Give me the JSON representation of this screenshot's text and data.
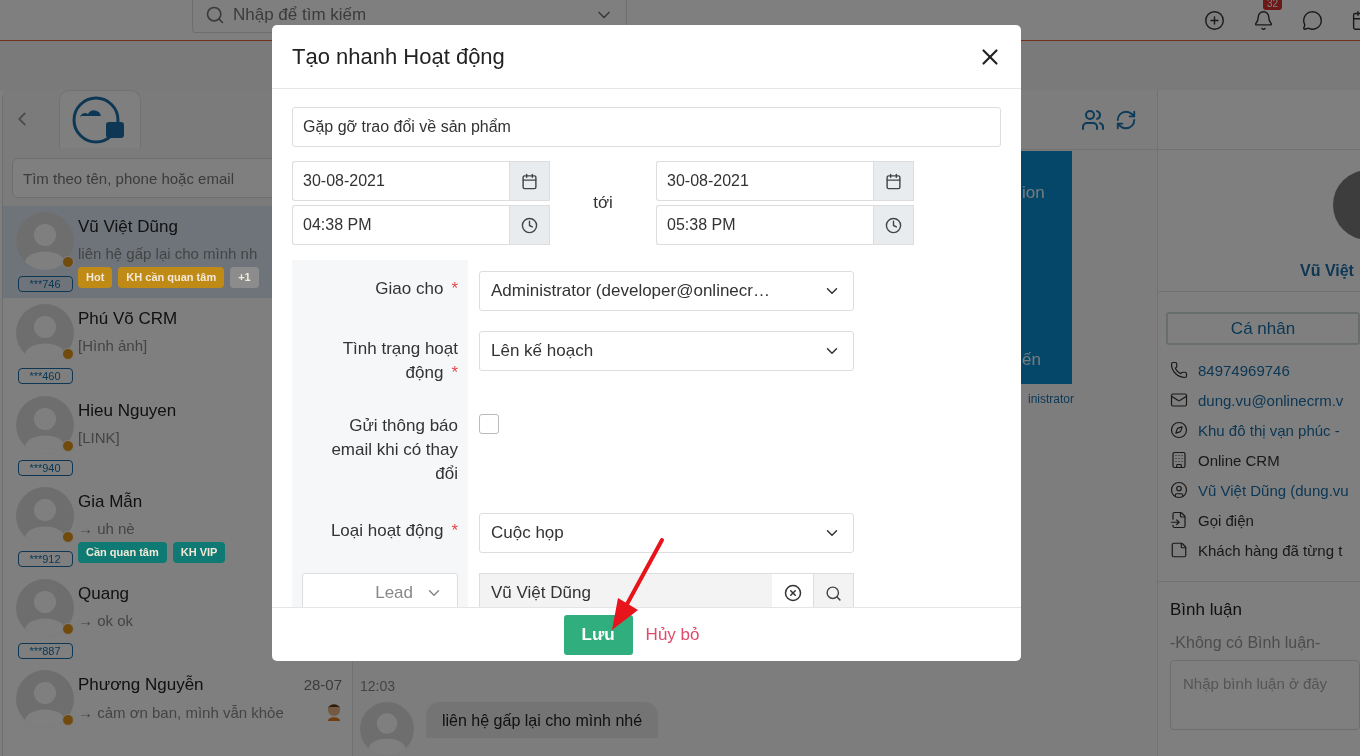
{
  "topbar": {
    "search_placeholder": "Nhập để tìm kiếm",
    "notification_count": "32"
  },
  "contacts": {
    "search_placeholder": "Tìm theo tên, phone hoặc email",
    "items": [
      {
        "name": "Vũ Việt Dũng",
        "preview": "liên hệ gấp lại cho mình nh",
        "code": "***746",
        "selected": true,
        "tags": [
          {
            "label": "Hot",
            "color": "#c08a16"
          },
          {
            "label": "KH cần quan tâm",
            "color": "#c08a16"
          },
          {
            "label": "+1",
            "color": "#8c8c8c"
          }
        ]
      },
      {
        "name": "Phú Võ CRM",
        "preview": "[Hình ảnh]",
        "code": "***460",
        "selected": false
      },
      {
        "name": "Hieu Nguyen",
        "preview": "[LINK]",
        "code": "***940",
        "selected": false
      },
      {
        "name": "Gia Mẫn",
        "preview": "→ uh nè",
        "code": "***912",
        "selected": false,
        "tags": [
          {
            "label": "Cần quan tâm",
            "color": "#0e7a73"
          },
          {
            "label": "KH VIP",
            "color": "#0e7a73"
          }
        ]
      },
      {
        "name": "Quang",
        "preview": "→ ok ok",
        "code": "***887",
        "selected": false
      },
      {
        "name": "Phương Nguyễn",
        "preview": "→ cảm ơn ban, mình vẫn khỏe",
        "time": "28-07",
        "selected": false
      }
    ]
  },
  "chat": {
    "card_texts": [
      "ion",
      "ến"
    ],
    "card_caption": "inistrator",
    "messages": [
      {
        "time": "12:03",
        "text": "liên hệ gấp lại cho mình nhé"
      }
    ]
  },
  "profile": {
    "name": "Vũ Việt",
    "tab": "Cá nhân",
    "details": [
      {
        "kind": "phone",
        "text": "84974969746",
        "link": true
      },
      {
        "kind": "email",
        "text": "dung.vu@onlinecrm.v",
        "link": true
      },
      {
        "kind": "address",
        "text": "Khu đô thị vạn phúc -",
        "link": true
      },
      {
        "kind": "company",
        "text": "Online CRM",
        "link": false
      },
      {
        "kind": "owner",
        "text": "Vũ Việt Dũng (dung.vu",
        "link": true
      },
      {
        "kind": "source",
        "text": "Gọi điện",
        "link": false
      },
      {
        "kind": "note",
        "text": "Khách hàng đã từng t",
        "link": false
      }
    ],
    "comments_title": "Bình luận",
    "comments_empty": "-Không có Bình luận-",
    "comment_placeholder": "Nhập bình luận ở đây"
  },
  "modal": {
    "title": "Tạo nhanh Hoạt động",
    "subject": "Gặp gỡ trao đổi về sản phẩm",
    "start": {
      "date": "30-08-2021",
      "time": "04:38 PM"
    },
    "range_separator": "tới",
    "end": {
      "date": "30-08-2021",
      "time": "05:38 PM"
    },
    "required_mark": "*",
    "fields": [
      {
        "kind": "select",
        "label": "Giao cho",
        "required": true,
        "value": "Administrator (developer@onlinecr…"
      },
      {
        "kind": "select",
        "label": "Tình trạng hoạt động",
        "required": true,
        "value": "Lên kế hoạch"
      },
      {
        "kind": "checkbox",
        "label": "Gửi thông báo email khi có thay đổi",
        "required": false,
        "checked": false
      },
      {
        "kind": "select",
        "label": "Loại hoạt động",
        "required": true,
        "value": "Cuộc họp"
      },
      {
        "kind": "lookup",
        "module": "Lead",
        "value": "Vũ Việt Dũng"
      }
    ],
    "save": "Lưu",
    "cancel": "Hủy bỏ"
  }
}
